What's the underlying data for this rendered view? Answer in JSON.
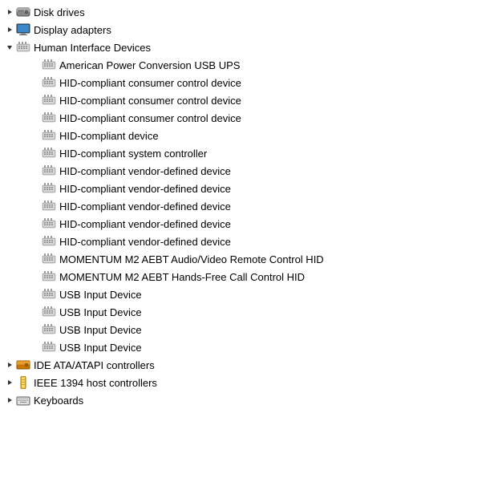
{
  "tree": {
    "items": [
      {
        "id": "disk-drives",
        "indent": 0,
        "toggle": "right",
        "icon": "hdd",
        "label": "Disk drives",
        "expanded": false
      },
      {
        "id": "display-adapters",
        "indent": 0,
        "toggle": "right",
        "icon": "display",
        "label": "Display adapters",
        "expanded": false
      },
      {
        "id": "human-interface-devices",
        "indent": 0,
        "toggle": "down",
        "icon": "hid-group",
        "label": "Human Interface Devices",
        "expanded": true
      },
      {
        "id": "apc-usb-ups",
        "indent": 2,
        "toggle": "",
        "icon": "hid",
        "label": "American Power Conversion USB UPS"
      },
      {
        "id": "hid-consumer-1",
        "indent": 2,
        "toggle": "",
        "icon": "hid",
        "label": "HID-compliant consumer control device"
      },
      {
        "id": "hid-consumer-2",
        "indent": 2,
        "toggle": "",
        "icon": "hid",
        "label": "HID-compliant consumer control device"
      },
      {
        "id": "hid-consumer-3",
        "indent": 2,
        "toggle": "",
        "icon": "hid",
        "label": "HID-compliant consumer control device"
      },
      {
        "id": "hid-device",
        "indent": 2,
        "toggle": "",
        "icon": "hid",
        "label": "HID-compliant device"
      },
      {
        "id": "hid-system-controller",
        "indent": 2,
        "toggle": "",
        "icon": "hid",
        "label": "HID-compliant system controller"
      },
      {
        "id": "hid-vendor-1",
        "indent": 2,
        "toggle": "",
        "icon": "hid",
        "label": "HID-compliant vendor-defined device"
      },
      {
        "id": "hid-vendor-2",
        "indent": 2,
        "toggle": "",
        "icon": "hid",
        "label": "HID-compliant vendor-defined device"
      },
      {
        "id": "hid-vendor-3",
        "indent": 2,
        "toggle": "",
        "icon": "hid",
        "label": "HID-compliant vendor-defined device"
      },
      {
        "id": "hid-vendor-4",
        "indent": 2,
        "toggle": "",
        "icon": "hid",
        "label": "HID-compliant vendor-defined device"
      },
      {
        "id": "hid-vendor-5",
        "indent": 2,
        "toggle": "",
        "icon": "hid",
        "label": "HID-compliant vendor-defined device"
      },
      {
        "id": "momentum-m2-av",
        "indent": 2,
        "toggle": "",
        "icon": "hid",
        "label": "MOMENTUM M2 AEBT Audio/Video Remote Control HID"
      },
      {
        "id": "momentum-m2-hf",
        "indent": 2,
        "toggle": "",
        "icon": "hid",
        "label": "MOMENTUM M2 AEBT Hands-Free Call Control HID"
      },
      {
        "id": "usb-input-1",
        "indent": 2,
        "toggle": "",
        "icon": "hid",
        "label": "USB Input Device"
      },
      {
        "id": "usb-input-2",
        "indent": 2,
        "toggle": "",
        "icon": "hid",
        "label": "USB Input Device"
      },
      {
        "id": "usb-input-3",
        "indent": 2,
        "toggle": "",
        "icon": "hid",
        "label": "USB Input Device"
      },
      {
        "id": "usb-input-4",
        "indent": 2,
        "toggle": "",
        "icon": "hid",
        "label": "USB Input Device"
      },
      {
        "id": "ide-controllers",
        "indent": 0,
        "toggle": "right",
        "icon": "ide",
        "label": "IDE ATA/ATAPI controllers",
        "expanded": false
      },
      {
        "id": "ieee-1394",
        "indent": 0,
        "toggle": "right",
        "icon": "ieee",
        "label": "IEEE 1394 host controllers",
        "expanded": false
      },
      {
        "id": "keyboards",
        "indent": 0,
        "toggle": "right",
        "icon": "keyboard",
        "label": "Keyboards",
        "expanded": false
      }
    ]
  }
}
